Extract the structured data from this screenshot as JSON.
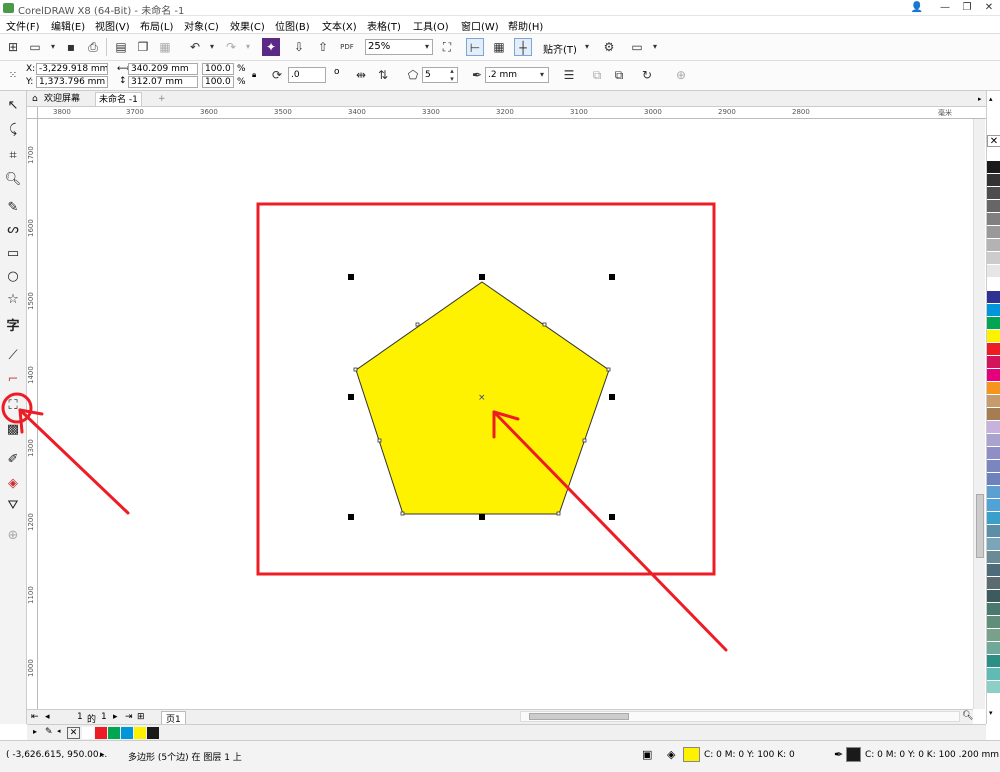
{
  "window": {
    "title": "CorelDRAW X8 (64-Bit) - 未命名 -1",
    "controls": [
      "👤",
      "—",
      "❐",
      "✕"
    ]
  },
  "menubar": {
    "items": [
      "文件(F)",
      "编辑(E)",
      "视图(V)",
      "布局(L)",
      "对象(C)",
      "效果(C)",
      "位图(B)",
      "文本(X)",
      "表格(T)",
      "工具(O)",
      "窗口(W)",
      "帮助(H)"
    ]
  },
  "toolbar": {
    "zoom": "25%",
    "snap_label": "贴齐(T)",
    "pdf_label": "PDF"
  },
  "propertybar": {
    "x_label": "X:",
    "x": "-3,229.918 mm",
    "y_label": "Y:",
    "y": "1,373.796 mm",
    "w": "340.209 mm",
    "h": "312.07 mm",
    "sx": "100.0",
    "sy": "100.0",
    "pct": "%",
    "rotation": ".0",
    "deg": "o",
    "sides": "5",
    "outline": ".2 mm"
  },
  "tabs": {
    "welcome": "欢迎屏幕",
    "doc": "未命名 -1",
    "add": "+"
  },
  "ruler": {
    "h": [
      "3800",
      "3700",
      "3600",
      "3500",
      "3400",
      "3300",
      "3200",
      "3100",
      "3000",
      "2900",
      "2800"
    ],
    "v": [
      "1700",
      "1600",
      "1500",
      "1400",
      "1300",
      "1200",
      "1100",
      "1000"
    ],
    "unit": "毫米"
  },
  "canvas": {
    "shape": "pentagon",
    "fill_color": "#fff200",
    "outline_color": "#333333",
    "annotation_color": "#ee1c24"
  },
  "pagebar": {
    "page_num": "1",
    "of": "的",
    "total": "1",
    "page_tab": "页1"
  },
  "palette": {
    "colors": [
      "#ffffff",
      "#1a1a1a",
      "#333333",
      "#4d4d4d",
      "#666666",
      "#808080",
      "#999999",
      "#b3b3b3",
      "#cccccc",
      "#e6e6e6",
      "#ffffff",
      "#2e3192",
      "#0096dc",
      "#00a651",
      "#fff200",
      "#ed1c24",
      "#d4145a",
      "#e5007e",
      "#f7941d",
      "#c69c6d",
      "#a67c52",
      "#c7b2de",
      "#a9a3cf",
      "#8f8fc7",
      "#7c86be",
      "#6d82bd",
      "#5ca0d2",
      "#4fa3d9",
      "#3aa0c9",
      "#5b8fa8",
      "#7aa4b8",
      "#6a8a96",
      "#4d6b78",
      "#5c6b70",
      "#3d5a5c",
      "#4a7a6e",
      "#5f8f7a",
      "#78a08a",
      "#6fa99a",
      "#2c8f86",
      "#5fbcb5",
      "#8ccfc6"
    ]
  },
  "docpalette": {
    "colors": [
      "#ffffff",
      "#ed1c24",
      "#00a651",
      "#0096dc",
      "#fff200",
      "#1a1a1a"
    ]
  },
  "status": {
    "coords": "( -3,626.615, 950.00...",
    "arrow": "▸",
    "object_info": "多边形 (5个边) 在 图层 1 上",
    "fill_label": "C: 0 M: 0 Y: 100 K: 0",
    "fill_color": "#fff200",
    "outline_label": "C: 0 M: 0 Y: 0 K: 100  .200 mm",
    "outline_color": "#1a1a1a"
  }
}
